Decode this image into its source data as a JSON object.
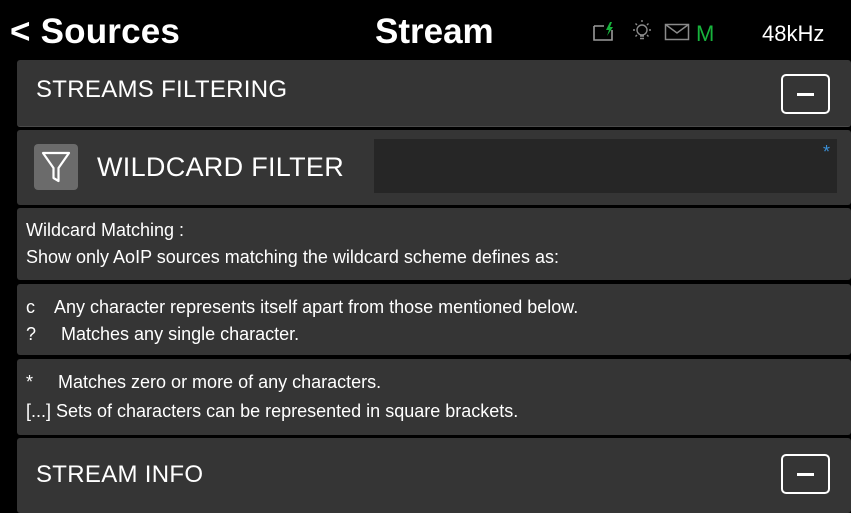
{
  "header": {
    "back_label": "< Sources",
    "title": "Stream",
    "status_icons": [
      "power-charging-icon",
      "bulb-icon",
      "mail-icon"
    ],
    "m_indicator": "M",
    "m_color": "#17b33c",
    "sample_rate": "48kHz"
  },
  "streams_filtering": {
    "label": "STREAMS FILTERING"
  },
  "wildcard_filter": {
    "label": "WILDCARD FILTER",
    "value": "",
    "required_mark": "*",
    "required_color": "#3a8fd6"
  },
  "help": {
    "intro_title": "Wildcard Matching :",
    "intro_text": "Show only AoIP sources matching the wildcard scheme defines as:",
    "rule_c": "c    Any character represents itself apart from those mentioned below.",
    "rule_q": "?     Matches any single character.",
    "rule_star": "*     Matches zero or more of any characters.",
    "rule_brackets": "[...] Sets of characters can be represented in square brackets."
  },
  "stream_info": {
    "label": "STREAM INFO"
  }
}
